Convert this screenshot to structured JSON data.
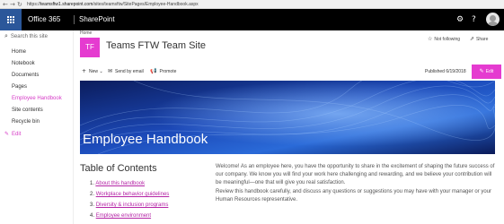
{
  "browser": {
    "url_prefix": "https://",
    "url_host": "teamsftw1.sharepoint.com",
    "url_path": "/sites/teamsftw/SitePages/Employee-Handbook.aspx"
  },
  "suite_bar": {
    "brand": "Office 365",
    "app": "SharePoint"
  },
  "left_nav": {
    "search_placeholder": "Search this site",
    "items": [
      {
        "label": "Home"
      },
      {
        "label": "Notebook"
      },
      {
        "label": "Documents"
      },
      {
        "label": "Pages"
      },
      {
        "label": "Employee Handbook"
      },
      {
        "label": "Site contents"
      },
      {
        "label": "Recycle bin"
      }
    ],
    "edit_label": "Edit"
  },
  "site_header": {
    "breadcrumb": "Home",
    "logo_initials": "TF",
    "title": "Teams FTW Team Site",
    "follow_label": "Not following",
    "share_label": "Share"
  },
  "command_bar": {
    "new_label": "New",
    "send_label": "Send by email",
    "promote_label": "Promote",
    "published": "Published 6/19/2018",
    "edit_label": "Edit"
  },
  "hero": {
    "title": "Employee Handbook"
  },
  "toc": {
    "title": "Table of Contents",
    "items": [
      {
        "number": "1.",
        "label": "About this handbook"
      },
      {
        "number": "2.",
        "label": "Workplace behavior guidelines"
      },
      {
        "number": "3.",
        "label": "Diversity & inclusion programs"
      },
      {
        "number": "4.",
        "label": "Employee environment"
      }
    ]
  },
  "body_text": {
    "paragraphs": [
      "Welcome! As an employee here, you have the opportunity to share in the excitement of shaping the future success of our company. We know you will find your work here challenging and rewarding, and we believe your contribution will be meaningful—one that will give you real satisfaction.",
      "Review this handbook carefully, and discuss any questions or suggestions you may have with your manager or your Human Resources representative."
    ]
  },
  "colors": {
    "accent": "#e53bd0",
    "suite_bar": "#000000",
    "waffle": "#2b579a",
    "hero_dark": "#0a1f66"
  }
}
